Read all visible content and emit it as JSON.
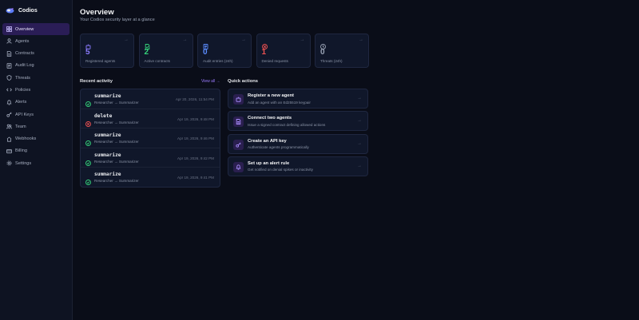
{
  "brand": {
    "name": "Codios"
  },
  "sidebar": {
    "items": [
      {
        "label": "Overview",
        "icon": "grid-icon",
        "active": true
      },
      {
        "label": "Agents",
        "icon": "users-icon"
      },
      {
        "label": "Contracts",
        "icon": "document-icon"
      },
      {
        "label": "Audit Log",
        "icon": "log-icon"
      },
      {
        "label": "Threats",
        "icon": "shield-icon"
      },
      {
        "label": "Policies",
        "icon": "code-icon"
      },
      {
        "label": "Alerts",
        "icon": "bell-icon"
      },
      {
        "label": "API Keys",
        "icon": "key-icon"
      },
      {
        "label": "Team",
        "icon": "team-icon"
      },
      {
        "label": "Webhooks",
        "icon": "webhook-icon"
      },
      {
        "label": "Billing",
        "icon": "card-icon"
      },
      {
        "label": "Settings",
        "icon": "gear-icon"
      }
    ]
  },
  "header": {
    "title": "Overview",
    "subtitle": "Your Codios security layer at a glance"
  },
  "stats": [
    {
      "value": "5",
      "label": "Registered agents",
      "color": "#8b7bff",
      "icon": "agent-icon"
    },
    {
      "value": "2",
      "label": "Active contracts",
      "color": "#34d37a",
      "icon": "contract-icon"
    },
    {
      "value": "0",
      "label": "Audit entries (24h)",
      "color": "#5b8cff",
      "icon": "log-icon"
    },
    {
      "value": "1",
      "label": "Denied requests",
      "color": "#f05252",
      "icon": "denied-icon"
    },
    {
      "value": "0",
      "label": "Threats (24h)",
      "color": "#9aa3b5",
      "icon": "clock-icon"
    }
  ],
  "recent_activity": {
    "title": "Recent activity",
    "view_all": "View all →",
    "rows": [
      {
        "action": "summarize",
        "path": "Researcher → Summarizer",
        "time": "Apr 20, 2026, 11:54 PM",
        "status": "allowed"
      },
      {
        "action": "delete",
        "path": "Researcher → Summarizer",
        "time": "Apr 19, 2026, 9:48 PM",
        "status": "denied"
      },
      {
        "action": "summarize",
        "path": "Researcher → Summarizer",
        "time": "Apr 19, 2026, 9:46 PM",
        "status": "allowed"
      },
      {
        "action": "summarize",
        "path": "Researcher → Summarizer",
        "time": "Apr 19, 2026, 9:42 PM",
        "status": "allowed"
      },
      {
        "action": "summarize",
        "path": "Researcher → Summarizer",
        "time": "Apr 19, 2026, 9:41 PM",
        "status": "allowed"
      }
    ]
  },
  "quick_actions": {
    "title": "Quick actions",
    "items": [
      {
        "title": "Register a new agent",
        "desc": "Add an agent with an Ed25519 keypair",
        "icon": "agent-icon"
      },
      {
        "title": "Connect two agents",
        "desc": "Issue a signed contract defining allowed actions",
        "icon": "contract-icon"
      },
      {
        "title": "Create an API key",
        "desc": "Authenticate agents programmatically",
        "icon": "key-icon"
      },
      {
        "title": "Set up an alert rule",
        "desc": "Get notified on denial spikes or inactivity",
        "icon": "bell-icon"
      }
    ]
  },
  "colors": {
    "accent": "#8b5cf6",
    "allowed": "#34d37a",
    "denied": "#f05252",
    "background": "#0a0d18"
  }
}
